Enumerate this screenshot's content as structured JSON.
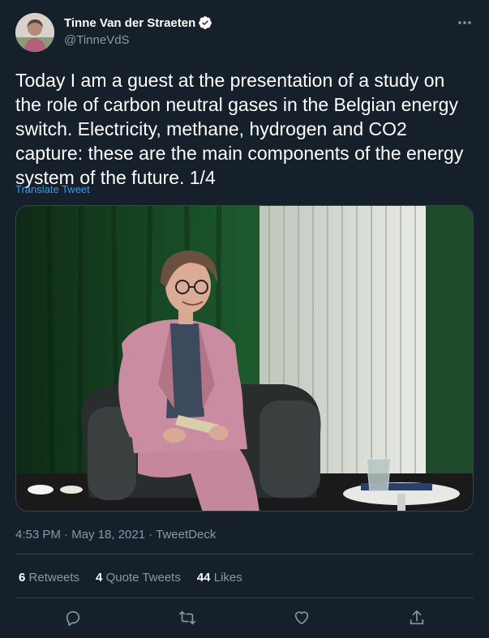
{
  "tweet": {
    "author": {
      "display_name": "Tinne Van der Straeten",
      "handle": "@TinneVdS",
      "verified": true
    },
    "text": "Today I am a guest at the presentation of a study on the role of carbon neutral gases in the Belgian energy switch. Electricity, methane, hydrogen and CO2 capture: these are the main components of the energy system of the future. 1/4",
    "translate_label": "Translate Tweet",
    "meta": "4:53 PM · May 18, 2021 · TweetDeck",
    "stats": {
      "retweets_count": "6",
      "retweets_label": "Retweets",
      "quote_count": "4",
      "quote_label": "Quote Tweets",
      "likes_count": "44",
      "likes_label": "Likes"
    }
  },
  "colors": {
    "background": "#15202b",
    "secondary_text": "#8899a6",
    "accent": "#1da1f2",
    "divider": "#38444d"
  },
  "icons": [
    "verified-badge-icon",
    "more-options-icon",
    "reply-icon",
    "retweet-icon",
    "like-icon",
    "share-icon"
  ]
}
